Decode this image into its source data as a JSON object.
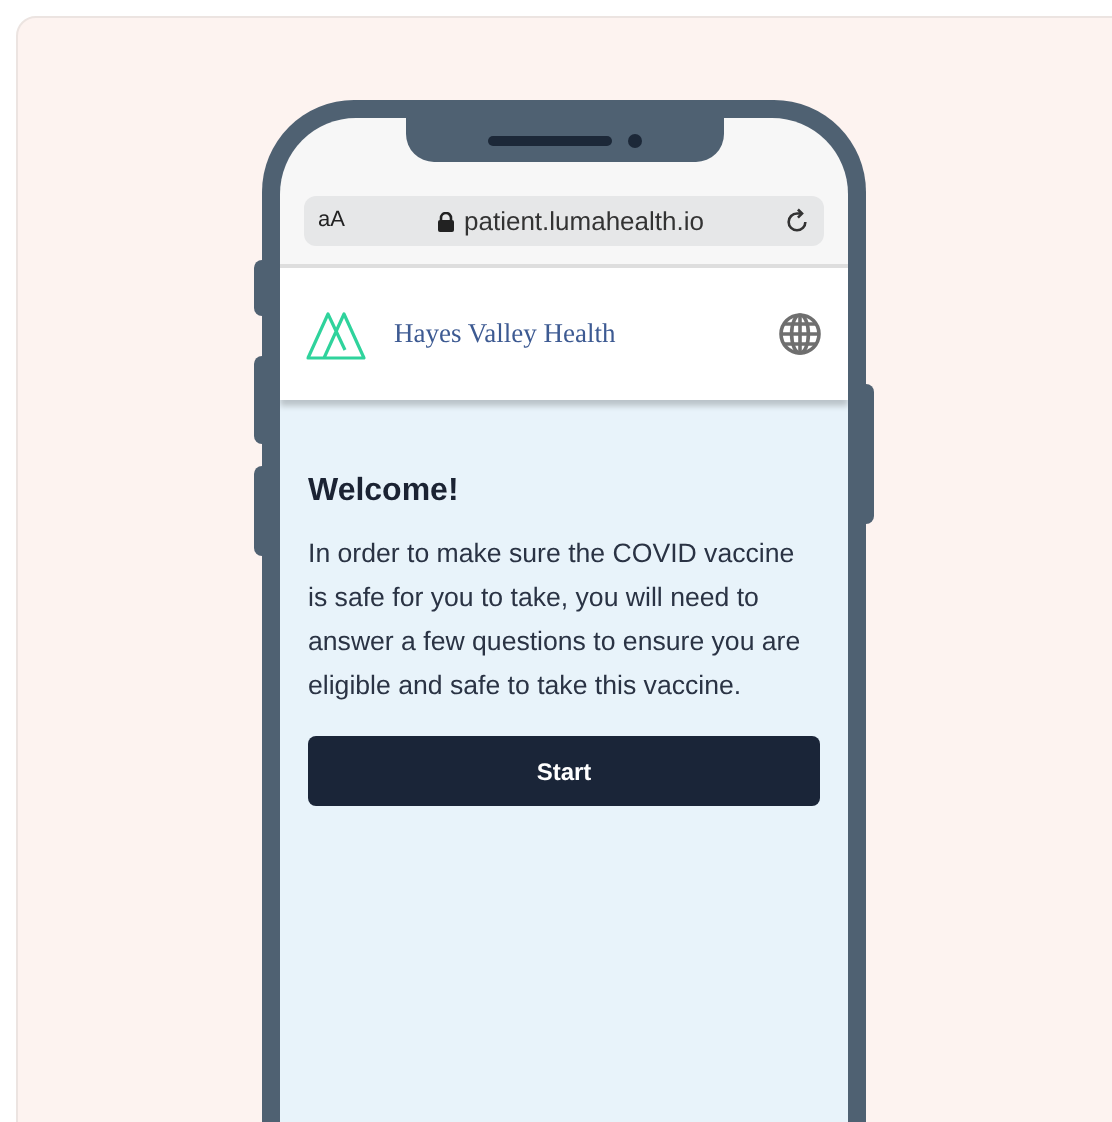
{
  "browser": {
    "text_size_button": "aA",
    "url": "patient.lumahealth.io"
  },
  "header": {
    "brand": "Hayes Valley Health"
  },
  "content": {
    "title": "Welcome!",
    "body": "In order to make sure the COVID vaccine is safe for you to take, you will need to answer a few questions to ensure you are eligible and safe to take this vaccine.",
    "button": "Start"
  }
}
